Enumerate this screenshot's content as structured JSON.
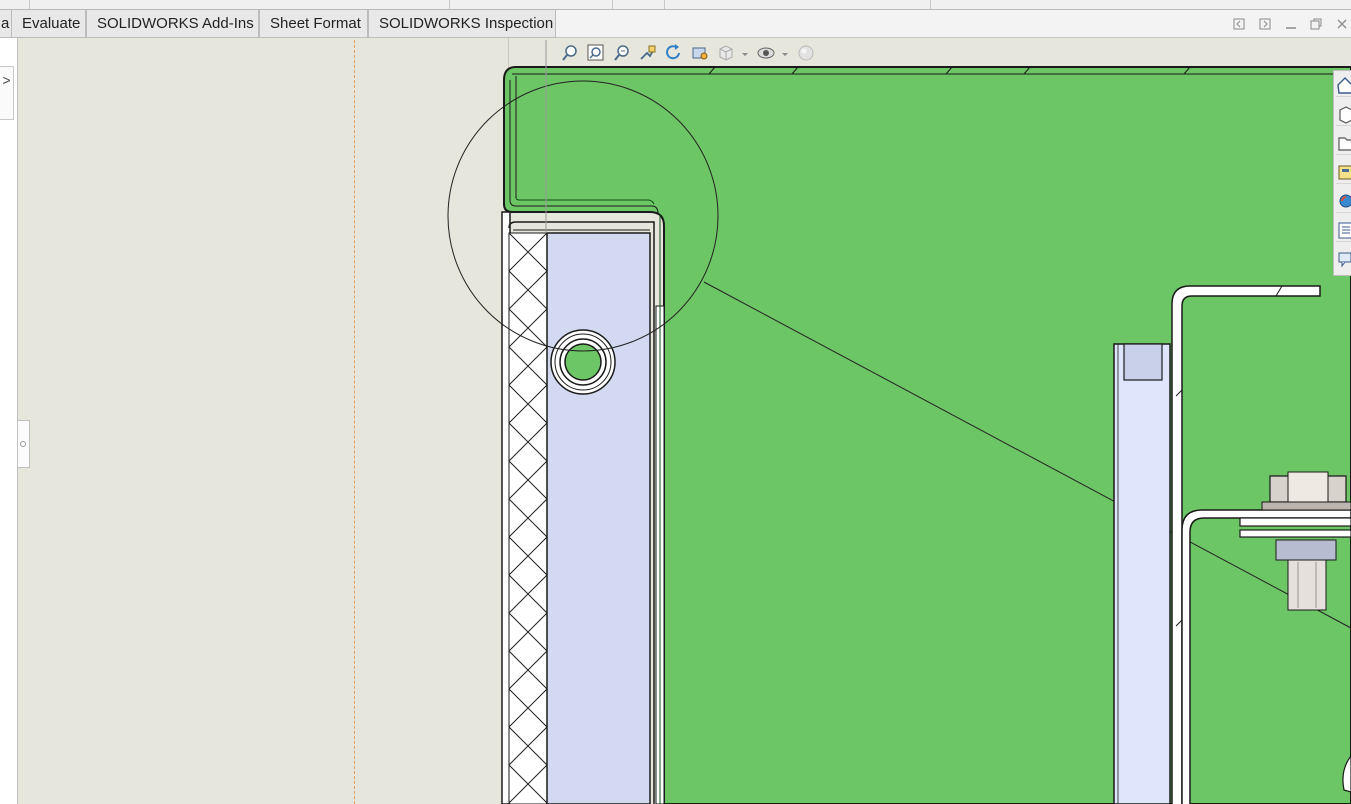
{
  "ribbon": {
    "tabs": [
      {
        "label": "a"
      },
      {
        "label": "Evaluate"
      },
      {
        "label": "SOLIDWORKS Add-Ins"
      },
      {
        "label": "Sheet Format"
      },
      {
        "label": "SOLIDWORKS Inspection"
      }
    ]
  },
  "window_controls": [
    "tile-left-icon",
    "tile-right-icon",
    "minimize-icon",
    "restore-icon",
    "close-icon"
  ],
  "left_rail": {
    "expand_glyph": ">"
  },
  "view_toolbar": {
    "icons": [
      "zoom-to-fit-icon",
      "zoom-to-area-icon",
      "zoom-in-out-icon",
      "pan-icon",
      "rotate-view-icon",
      "previous-view-icon",
      "display-style-icon",
      "hide-show-items-icon",
      "edit-appearance-icon"
    ]
  },
  "task_pane": {
    "icons": [
      "home-icon",
      "3d-parts-icon",
      "file-explorer-icon",
      "view-palette-icon",
      "appearances-icon",
      "custom-properties-icon",
      "forum-icon"
    ]
  },
  "colors": {
    "body_green": "#6dc665",
    "bracket_fill": "#d2d9f0",
    "spacer_fill": "#dfe6fb",
    "panel_bg": "#e6e6dc"
  }
}
